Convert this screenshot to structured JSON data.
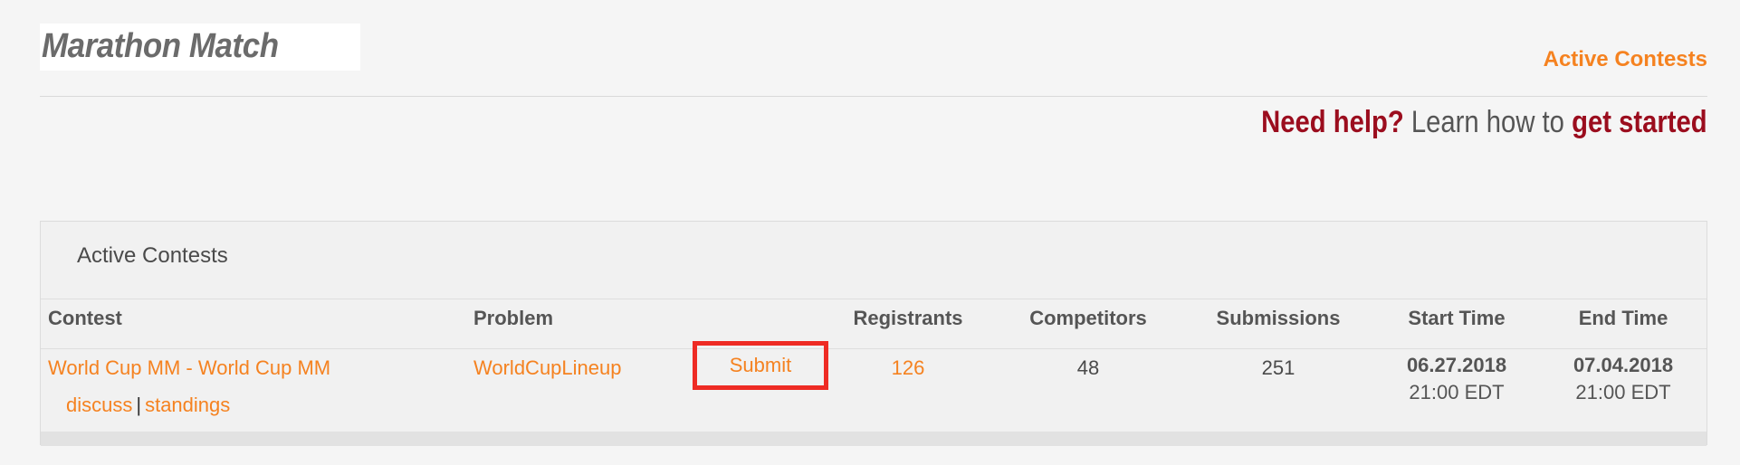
{
  "header": {
    "logo_text": "Marathon Match",
    "active_contests_link": "Active Contests",
    "help_prefix": "Need help?",
    "help_middle": "Learn how to",
    "help_link": "get started"
  },
  "panel": {
    "title": "Active Contests",
    "columns": [
      "Contest",
      "Problem",
      "Registrants",
      "Competitors",
      "Submissions",
      "Start Time",
      "End Time"
    ],
    "rows": [
      {
        "contest": "World Cup MM - World Cup MM",
        "discuss": "discuss",
        "separator": "|",
        "standings": "standings",
        "problem": "WorldCupLineup",
        "submit": "Submit",
        "registrants": "126",
        "competitors": "48",
        "submissions": "251",
        "start_date": "06.27.2018",
        "start_time": "21:00 EDT",
        "end_date": "07.04.2018",
        "end_time": "21:00 EDT"
      }
    ]
  },
  "colors": {
    "accent": "#f58220",
    "help_red": "#9b0d1e",
    "highlight_box": "#ee2b24"
  }
}
